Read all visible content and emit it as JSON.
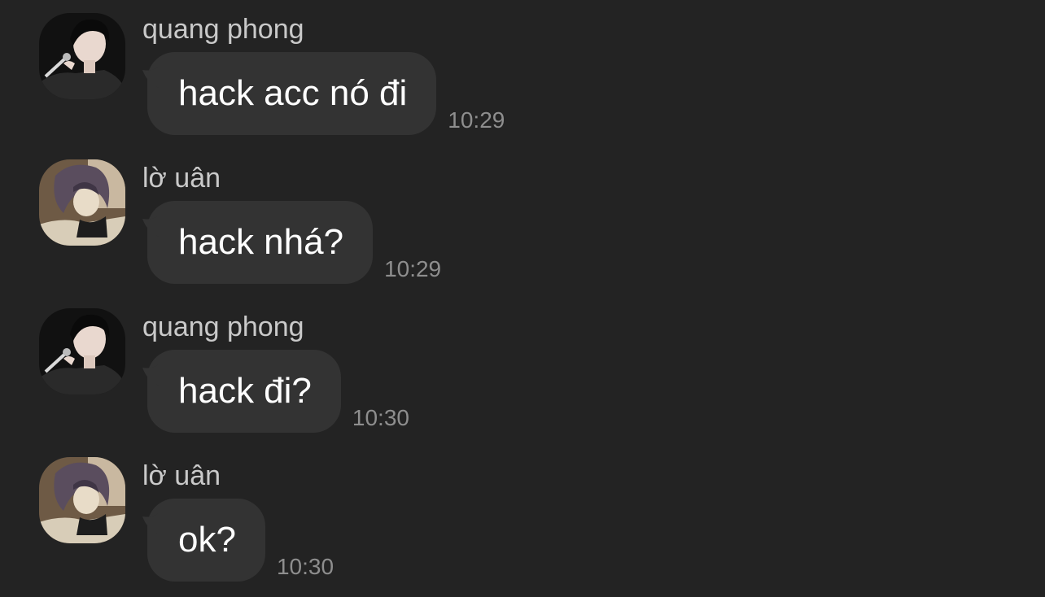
{
  "messages": [
    {
      "sender": "quang phong",
      "text": "hack acc nó đi",
      "time": "10:29",
      "avatar": "singer-avatar-icon"
    },
    {
      "sender": "lờ uân",
      "text": "hack nhá?",
      "time": "10:29",
      "avatar": "anime-avatar-icon"
    },
    {
      "sender": "quang phong",
      "text": "hack đi?",
      "time": "10:30",
      "avatar": "singer-avatar-icon"
    },
    {
      "sender": "lờ uân",
      "text": "ok?",
      "time": "10:30",
      "avatar": "anime-avatar-icon"
    }
  ],
  "colors": {
    "background": "#232323",
    "bubble": "#333333",
    "text": "#ffffff",
    "sender": "#c9c9c9",
    "time": "#8e8e8e"
  }
}
